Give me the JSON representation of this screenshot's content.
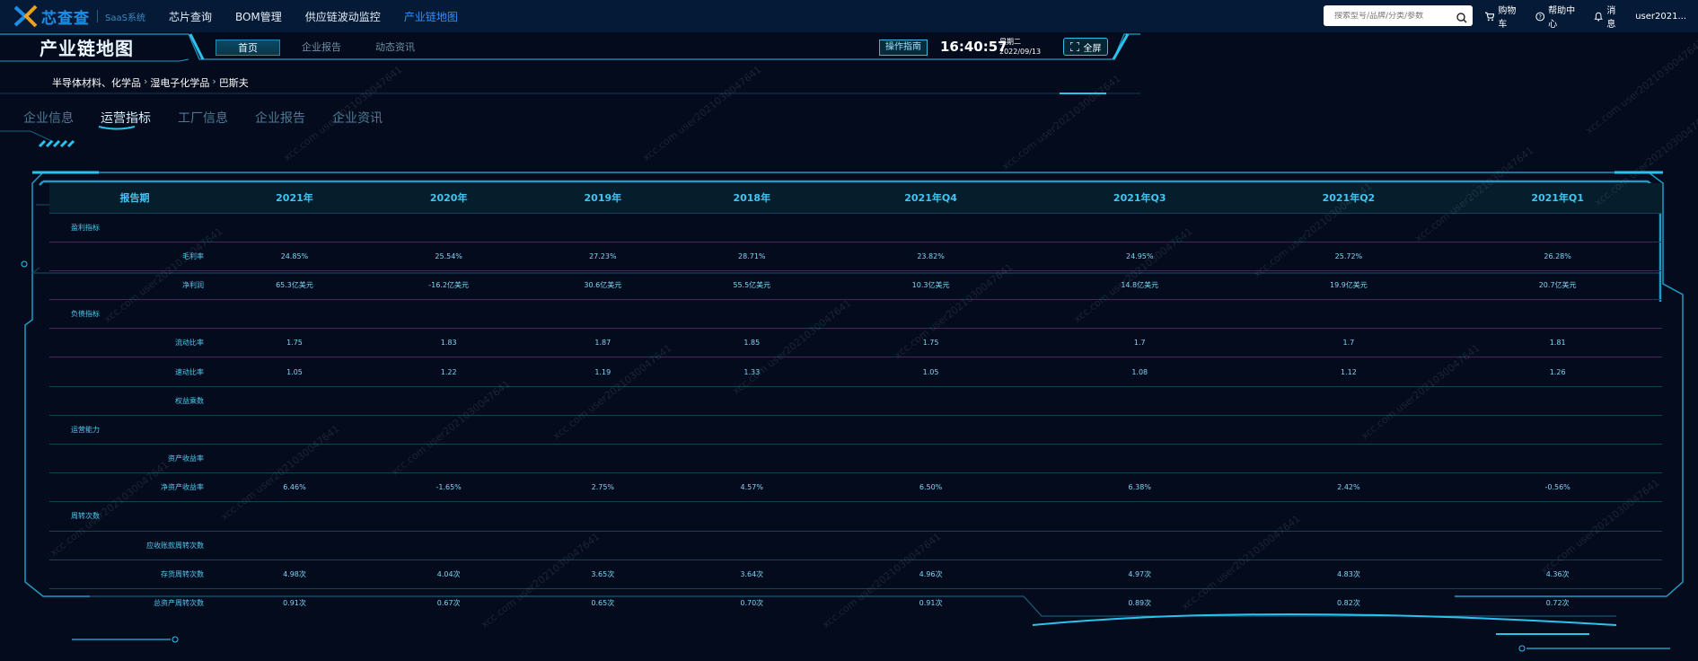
{
  "topbar": {
    "logo_text": "芯查查",
    "logo_sub": "SaaS系统",
    "nav": [
      {
        "label": "芯片查询",
        "active": false
      },
      {
        "label": "BOM管理",
        "active": false
      },
      {
        "label": "供应链波动监控",
        "active": false
      },
      {
        "label": "产业链地图",
        "active": true
      }
    ],
    "search_placeholder": "搜索型号/品牌/分类/参数",
    "cart": "购物车",
    "help": "帮助中心",
    "messages": "消息",
    "user": "user2021..."
  },
  "header": {
    "title": "产业链地图",
    "tabs": [
      {
        "label": "首页",
        "active": true
      },
      {
        "label": "企业报告",
        "active": false
      },
      {
        "label": "动态资讯",
        "active": false
      }
    ],
    "guide": "操作指南",
    "time": "16:40:57",
    "weekday": "星期二",
    "date": "2022/09/13",
    "fullscreen": "全屏"
  },
  "breadcrumb": [
    "半导体材料、化学品",
    "湿电子化学品",
    "巴斯夫"
  ],
  "subtabs": [
    {
      "label": "企业信息",
      "active": false
    },
    {
      "label": "运营指标",
      "active": true
    },
    {
      "label": "工厂信息",
      "active": false
    },
    {
      "label": "企业报告",
      "active": false
    },
    {
      "label": "企业资讯",
      "active": false
    }
  ],
  "table": {
    "header_label": "报告期",
    "columns": [
      "2021年",
      "2020年",
      "2019年",
      "2018年",
      "2021年Q4",
      "2021年Q3",
      "2021年Q2",
      "2021年Q1"
    ],
    "rows": [
      {
        "kind": "group",
        "label": "盈利指标",
        "values": [
          "",
          "",
          "",
          "",
          "",
          "",
          "",
          ""
        ]
      },
      {
        "kind": "metric",
        "label": "毛利率",
        "values": [
          "24.85%",
          "25.54%",
          "27.23%",
          "28.71%",
          "23.82%",
          "24.95%",
          "25.72%",
          "26.28%"
        ]
      },
      {
        "kind": "metric",
        "label": "净利润",
        "values": [
          "65.3亿美元",
          "-16.2亿美元",
          "30.6亿美元",
          "55.5亿美元",
          "10.3亿美元",
          "14.8亿美元",
          "19.9亿美元",
          "20.7亿美元"
        ]
      },
      {
        "kind": "group",
        "label": "负债指标",
        "values": [
          "",
          "",
          "",
          "",
          "",
          "",
          "",
          ""
        ]
      },
      {
        "kind": "metric",
        "label": "流动比率",
        "values": [
          "1.75",
          "1.83",
          "1.87",
          "1.85",
          "1.75",
          "1.7",
          "1.7",
          "1.81"
        ]
      },
      {
        "kind": "metric",
        "label": "速动比率",
        "values": [
          "1.05",
          "1.22",
          "1.19",
          "1.33",
          "1.05",
          "1.08",
          "1.12",
          "1.26"
        ]
      },
      {
        "kind": "metric",
        "label": "权益乘数",
        "values": [
          "",
          "",
          "",
          "",
          "",
          "",
          "",
          ""
        ]
      },
      {
        "kind": "group",
        "label": "运营能力",
        "values": [
          "",
          "",
          "",
          "",
          "",
          "",
          "",
          ""
        ]
      },
      {
        "kind": "metric",
        "label": "资产收益率",
        "values": [
          "",
          "",
          "",
          "",
          "",
          "",
          "",
          ""
        ]
      },
      {
        "kind": "metric",
        "label": "净资产收益率",
        "values": [
          "6.46%",
          "-1.65%",
          "2.75%",
          "4.57%",
          "6.50%",
          "6.38%",
          "2.42%",
          "-0.56%"
        ]
      },
      {
        "kind": "group",
        "label": "周转次数",
        "values": [
          "",
          "",
          "",
          "",
          "",
          "",
          "",
          ""
        ]
      },
      {
        "kind": "metric",
        "label": "应收账款周转次数",
        "values": [
          "",
          "",
          "",
          "",
          "",
          "",
          "",
          ""
        ]
      },
      {
        "kind": "metric",
        "label": "存货周转次数",
        "values": [
          "4.98次",
          "4.04次",
          "3.65次",
          "3.64次",
          "4.96次",
          "4.97次",
          "4.83次",
          "4.36次"
        ]
      },
      {
        "kind": "metric",
        "label": "总资产周转次数",
        "values": [
          "0.91次",
          "0.67次",
          "0.65次",
          "0.70次",
          "0.91次",
          "0.89次",
          "0.82次",
          "0.72次"
        ]
      }
    ]
  },
  "watermark": "xcc.com user2021030047641",
  "colors": {
    "accent": "#2f8fff",
    "cyan": "#42c4f0",
    "bg": "#040b1c",
    "frame": "#1f9cc4"
  }
}
